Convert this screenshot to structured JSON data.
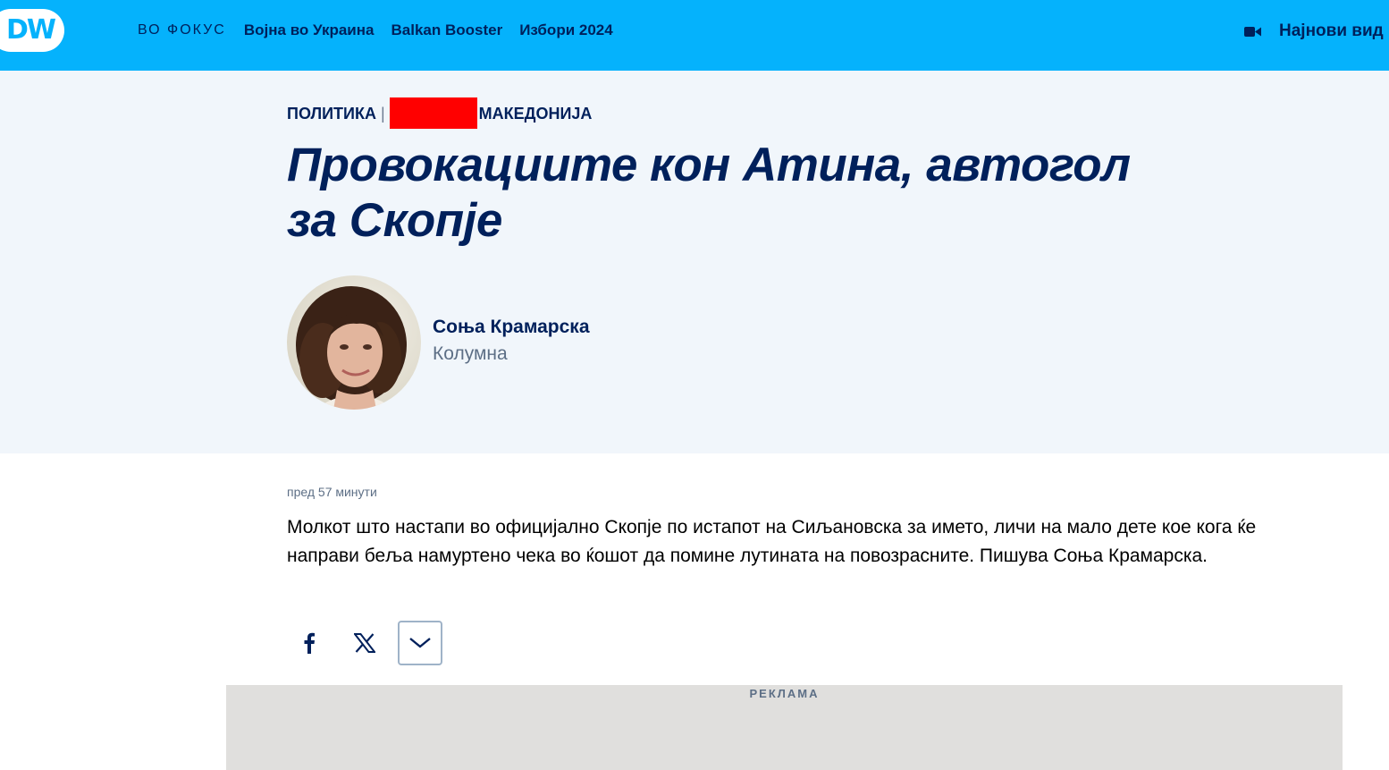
{
  "header": {
    "logo_text": "DW",
    "nav": {
      "focus_label": "ВО ФОКУС",
      "links": [
        "Војна во Украина",
        "Balkan Booster",
        "Избори 2024"
      ]
    },
    "latest_videos_label": "Најнови вид"
  },
  "article": {
    "kicker": {
      "category": "ПОЛИТИКА",
      "separator": "|",
      "region": "МАКЕДОНИЈА"
    },
    "headline": "Провокациите кон Атина, автогол за Скопје",
    "author": {
      "name": "Соња Крамарска",
      "role": "Колумна"
    },
    "published": "пред 57 минути",
    "lead": "Молкот што настапи во официјално Скопје по истапот на Сиљановска за името, личи на мало дете кое кога ќе направи беља намуртено чека во ќошот да помине лутината на повозрасните. Пишува Соња Крамарска."
  },
  "ad": {
    "label": "РЕКЛАМА"
  },
  "colors": {
    "brand_blue": "#05b2fc",
    "navy": "#00205b",
    "hero_bg": "#f1f6fb",
    "redaction": "#ff0000"
  }
}
